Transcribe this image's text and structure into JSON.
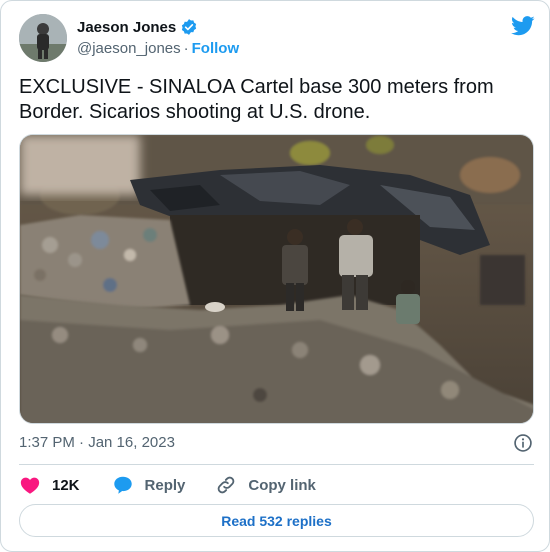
{
  "author": {
    "name": "Jaeson Jones",
    "handle": "@jaeson_jones",
    "separator": "·",
    "follow_label": "Follow"
  },
  "tweet": {
    "text": "EXCLUSIVE - SINALOA Cartel base 300 meters from Border. Sicarios shooting at U.S. drone."
  },
  "meta": {
    "timestamp": "1:37 PM · Jan 16, 2023"
  },
  "actions": {
    "likes_count": "12K",
    "reply_label": "Reply",
    "copy_link_label": "Copy link"
  },
  "replies_button": "Read 532 replies",
  "colors": {
    "brand_blue": "#1d9bf0",
    "like_red": "#f91880",
    "secondary_text": "#536471",
    "border": "#cfd9de"
  },
  "icons": [
    "verified-badge-icon",
    "twitter-bird-icon",
    "info-icon",
    "heart-icon",
    "reply-bubble-icon",
    "link-icon"
  ]
}
